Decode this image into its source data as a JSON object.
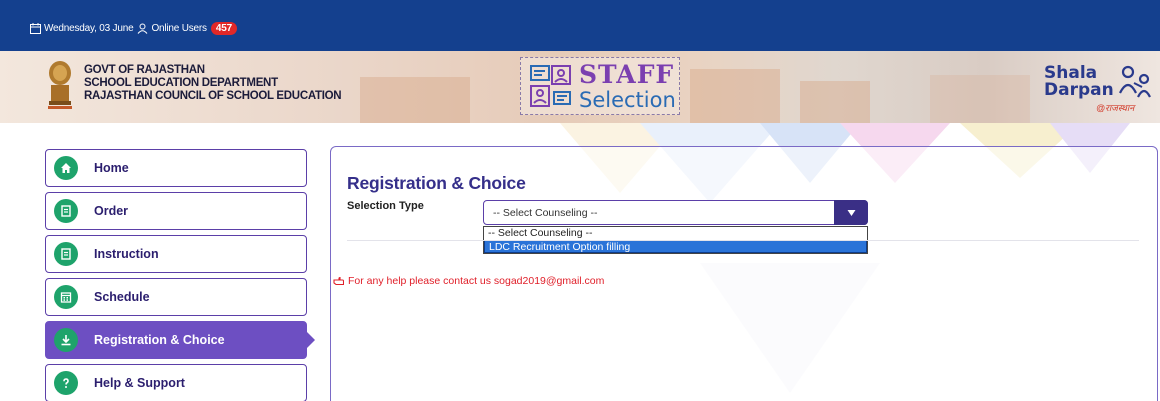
{
  "topbar": {
    "date": "Wednesday, 03 June",
    "online_label": "Online Users",
    "online_count": "457"
  },
  "header": {
    "govt_line1": "GOVT OF RAJASTHAN",
    "govt_line2": "SCHOOL EDUCATION DEPARTMENT",
    "govt_line3": "RAJASTHAN COUNCIL OF SCHOOL EDUCATION",
    "logo_staff": "STAFF",
    "logo_selection": "Selection",
    "shala_s": "Shala",
    "shala_darpan": "Darpan",
    "shala_tag": "@राजस्थान"
  },
  "sidebar": {
    "items": [
      {
        "label": "Home",
        "icon": "home-icon"
      },
      {
        "label": "Order",
        "icon": "document-icon"
      },
      {
        "label": "Instruction",
        "icon": "document-icon"
      },
      {
        "label": "Schedule",
        "icon": "calendar-icon"
      },
      {
        "label": "Registration & Choice",
        "icon": "download-icon",
        "active": true
      },
      {
        "label": "Help & Support",
        "icon": "question-icon"
      }
    ]
  },
  "main": {
    "title": "Registration & Choice",
    "field_label": "Selection Type",
    "select_value": "-- Select Counseling --",
    "options": [
      "-- Select Counseling --",
      "LDC Recruitment Option filling"
    ],
    "help_text": "For any help please contact us sogad2019@gmail.com"
  },
  "colors": {
    "topbar": "#14408e",
    "accent": "#6d4fc2",
    "nav_icon": "#1ea36b",
    "help_text": "#e0202a"
  }
}
